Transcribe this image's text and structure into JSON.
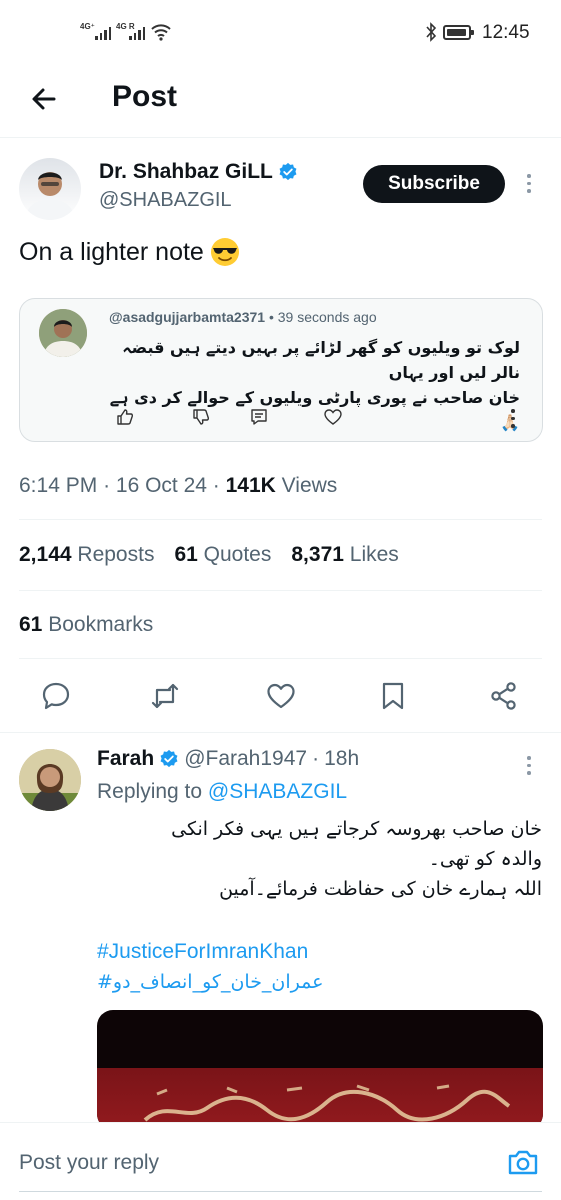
{
  "status_bar": {
    "signal1": "4G⁺",
    "signal2": "4G R",
    "time": "12:45"
  },
  "header": {
    "title": "Post"
  },
  "post": {
    "author_name": "Dr. Shahbaz GiLL",
    "author_handle": "@SHABAZGIL",
    "subscribe_label": "Subscribe",
    "text": "On a lighter note",
    "embed": {
      "handle": "@asadgujjarbamta2371",
      "time": "39 seconds ago",
      "line1": "لوک تو ویلیوں کو گھر لڑائے پر بہیں دیتے ہیں قبضہ نالر لیں اور یہاں",
      "line2": "خان صاحب نے پوری پارٹی ویلیوں کے حوالے کر دی ہے 🙏🏻"
    },
    "time": "6:14 PM",
    "date": "16 Oct 24",
    "views_count": "141K",
    "views_label": "Views",
    "reposts_count": "2,144",
    "reposts_label": "Reposts",
    "quotes_count": "61",
    "quotes_label": "Quotes",
    "likes_count": "8,371",
    "likes_label": "Likes",
    "bookmarks_count": "61",
    "bookmarks_label": "Bookmarks"
  },
  "reply": {
    "name": "Farah",
    "handle": "@Farah1947",
    "time": "18h",
    "replying_prefix": "Replying to",
    "replying_to": "@SHABAZGIL",
    "line1": "خان صاحب بھروسہ کرجاتے ہیں یہی فکر انکی",
    "line2": "والدہ کو تھی۔",
    "line3": "اللہ ہمارے خان کی حفاظت فرمائے۔آمین",
    "hashtag1": "#JusticeForImranKhan",
    "hashtag2": "#عمران_خان_کو_انصاف_دو"
  },
  "composer": {
    "placeholder": "Post your reply"
  },
  "colors": {
    "accent": "#1d9bf0",
    "text": "#0f1419",
    "muted": "#536471"
  },
  "icons": [
    "back-arrow-icon",
    "verified-badge-icon",
    "more-icon",
    "reply-icon",
    "repost-icon",
    "like-icon",
    "bookmark-icon",
    "share-icon",
    "camera-icon"
  ]
}
